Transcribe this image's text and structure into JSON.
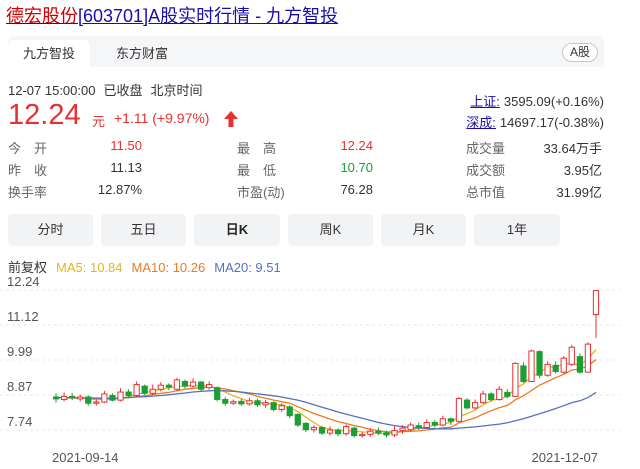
{
  "page": {
    "title_red": "德宏股份",
    "title_rest": "[603701]A股实时行情 - 九方智投"
  },
  "source_tabs": [
    {
      "label": "九方智投",
      "active": true
    },
    {
      "label": "东方财富",
      "active": false
    }
  ],
  "market_badge": "A股",
  "status": {
    "time": "12-07 15:00:00",
    "state": "已收盘",
    "zone": "北京时间"
  },
  "quote": {
    "price": "12.24",
    "unit": "元",
    "change": "+1.11 (+9.97%)",
    "direction": "up",
    "up_color": "#e93030",
    "down_color": "#1a9e36"
  },
  "indices": [
    {
      "label": "上证:",
      "value": "3595.09(+0.16%)"
    },
    {
      "label": "深成:",
      "value": "14697.17(-0.38%)"
    }
  ],
  "stats": [
    [
      {
        "label": "今　开",
        "value": "11.50",
        "color": "red"
      },
      {
        "label": "最　高",
        "value": "12.24",
        "color": "red"
      },
      {
        "label": "成交量",
        "value": "33.64万手",
        "color": ""
      }
    ],
    [
      {
        "label": "昨　收",
        "value": "11.13",
        "color": ""
      },
      {
        "label": "最　低",
        "value": "10.70",
        "color": "green"
      },
      {
        "label": "成交额",
        "value": "3.95亿",
        "color": ""
      }
    ],
    [
      {
        "label": "换手率",
        "value": "12.87%",
        "color": ""
      },
      {
        "label": "市盈(动)",
        "value": "76.28",
        "color": ""
      },
      {
        "label": "总市值",
        "value": "31.99亿",
        "color": ""
      }
    ]
  ],
  "period_tabs": [
    {
      "label": "分时",
      "active": false
    },
    {
      "label": "五日",
      "active": false
    },
    {
      "label": "日K",
      "active": true
    },
    {
      "label": "周K",
      "active": false
    },
    {
      "label": "月K",
      "active": false
    },
    {
      "label": "1年",
      "active": false
    }
  ],
  "ma_legend": {
    "adjust": "前复权",
    "items": [
      {
        "label": "MA5: 10.84",
        "color": "#e6b422"
      },
      {
        "label": "MA10: 10.26",
        "color": "#f07a1a"
      },
      {
        "label": "MA20: 9.51",
        "color": "#5470c6"
      }
    ]
  },
  "chart_data": {
    "type": "candlestick",
    "y_ticks": [
      "12.24",
      "11.12",
      "9.99",
      "8.87",
      "7.74"
    ],
    "y_range": [
      7.74,
      12.24
    ],
    "x_labels": [
      "2021-09-14",
      "2021-12-07"
    ],
    "up_color": "#e93030",
    "down_color": "#1a9e36",
    "candles": [
      {
        "o": 8.8,
        "c": 8.74,
        "h": 8.92,
        "l": 8.62
      },
      {
        "o": 8.72,
        "c": 8.82,
        "h": 8.95,
        "l": 8.66
      },
      {
        "o": 8.82,
        "c": 8.78,
        "h": 8.93,
        "l": 8.7
      },
      {
        "o": 8.74,
        "c": 8.8,
        "h": 8.88,
        "l": 8.66
      },
      {
        "o": 8.8,
        "c": 8.6,
        "h": 8.86,
        "l": 8.52
      },
      {
        "o": 8.6,
        "c": 8.64,
        "h": 8.72,
        "l": 8.52
      },
      {
        "o": 8.64,
        "c": 8.9,
        "h": 9.0,
        "l": 8.6
      },
      {
        "o": 8.85,
        "c": 8.7,
        "h": 8.92,
        "l": 8.66
      },
      {
        "o": 8.7,
        "c": 8.96,
        "h": 9.08,
        "l": 8.66
      },
      {
        "o": 8.96,
        "c": 8.85,
        "h": 9.05,
        "l": 8.76
      },
      {
        "o": 8.85,
        "c": 9.2,
        "h": 9.3,
        "l": 8.78
      },
      {
        "o": 9.15,
        "c": 8.92,
        "h": 9.2,
        "l": 8.86
      },
      {
        "o": 8.92,
        "c": 9.05,
        "h": 9.2,
        "l": 8.86
      },
      {
        "o": 9.05,
        "c": 9.18,
        "h": 9.28,
        "l": 8.98
      },
      {
        "o": 9.18,
        "c": 9.12,
        "h": 9.24,
        "l": 9.02
      },
      {
        "o": 9.05,
        "c": 9.35,
        "h": 9.42,
        "l": 9.0
      },
      {
        "o": 9.3,
        "c": 9.15,
        "h": 9.36,
        "l": 9.08
      },
      {
        "o": 9.15,
        "c": 9.28,
        "h": 9.4,
        "l": 9.1
      },
      {
        "o": 9.28,
        "c": 9.05,
        "h": 9.32,
        "l": 8.98
      },
      {
        "o": 9.1,
        "c": 9.2,
        "h": 9.3,
        "l": 9.04
      },
      {
        "o": 9.1,
        "c": 8.72,
        "h": 9.14,
        "l": 8.66
      },
      {
        "o": 8.72,
        "c": 8.6,
        "h": 8.8,
        "l": 8.52
      },
      {
        "o": 8.6,
        "c": 8.65,
        "h": 8.72,
        "l": 8.55
      },
      {
        "o": 8.66,
        "c": 8.58,
        "h": 8.74,
        "l": 8.52
      },
      {
        "o": 8.58,
        "c": 8.68,
        "h": 8.78,
        "l": 8.52
      },
      {
        "o": 8.68,
        "c": 8.55,
        "h": 8.74,
        "l": 8.48
      },
      {
        "o": 8.55,
        "c": 8.62,
        "h": 8.7,
        "l": 8.46
      },
      {
        "o": 8.62,
        "c": 8.4,
        "h": 8.66,
        "l": 8.34
      },
      {
        "o": 8.4,
        "c": 8.52,
        "h": 8.6,
        "l": 8.32
      },
      {
        "o": 8.48,
        "c": 8.2,
        "h": 8.54,
        "l": 8.12
      },
      {
        "o": 8.24,
        "c": 7.9,
        "h": 8.28,
        "l": 7.84
      },
      {
        "o": 7.95,
        "c": 7.75,
        "h": 8.0,
        "l": 7.68
      },
      {
        "o": 7.75,
        "c": 7.82,
        "h": 7.9,
        "l": 7.66
      },
      {
        "o": 7.82,
        "c": 7.64,
        "h": 7.88,
        "l": 7.58
      },
      {
        "o": 7.64,
        "c": 7.74,
        "h": 7.86,
        "l": 7.56
      },
      {
        "o": 7.74,
        "c": 7.62,
        "h": 7.8,
        "l": 7.54
      },
      {
        "o": 7.62,
        "c": 7.85,
        "h": 7.92,
        "l": 7.56
      },
      {
        "o": 7.8,
        "c": 7.56,
        "h": 7.84,
        "l": 7.5
      },
      {
        "o": 7.56,
        "c": 7.6,
        "h": 7.68,
        "l": 7.5
      },
      {
        "o": 7.6,
        "c": 7.7,
        "h": 7.8,
        "l": 7.52
      },
      {
        "o": 7.7,
        "c": 7.65,
        "h": 7.82,
        "l": 7.58
      },
      {
        "o": 7.65,
        "c": 7.58,
        "h": 7.72,
        "l": 7.5
      },
      {
        "o": 7.58,
        "c": 7.72,
        "h": 7.86,
        "l": 7.52
      },
      {
        "o": 7.72,
        "c": 7.8,
        "h": 7.9,
        "l": 7.62
      },
      {
        "o": 7.75,
        "c": 7.9,
        "h": 7.98,
        "l": 7.68
      },
      {
        "o": 7.88,
        "c": 7.82,
        "h": 7.98,
        "l": 7.74
      },
      {
        "o": 7.82,
        "c": 7.98,
        "h": 8.08,
        "l": 7.78
      },
      {
        "o": 7.98,
        "c": 7.9,
        "h": 8.06,
        "l": 7.82
      },
      {
        "o": 7.9,
        "c": 8.1,
        "h": 8.2,
        "l": 7.86
      },
      {
        "o": 8.1,
        "c": 8.02,
        "h": 8.14,
        "l": 7.9
      },
      {
        "o": 8.02,
        "c": 8.75,
        "h": 8.8,
        "l": 7.98
      },
      {
        "o": 8.7,
        "c": 8.45,
        "h": 8.76,
        "l": 8.4
      },
      {
        "o": 8.45,
        "c": 8.62,
        "h": 8.72,
        "l": 8.4
      },
      {
        "o": 8.62,
        "c": 8.9,
        "h": 9.0,
        "l": 8.58
      },
      {
        "o": 8.9,
        "c": 8.72,
        "h": 8.95,
        "l": 8.65
      },
      {
        "o": 8.72,
        "c": 9.05,
        "h": 9.15,
        "l": 8.68
      },
      {
        "o": 8.95,
        "c": 8.82,
        "h": 9.05,
        "l": 8.76
      },
      {
        "o": 8.82,
        "c": 9.88,
        "h": 9.92,
        "l": 8.8
      },
      {
        "o": 9.8,
        "c": 9.3,
        "h": 9.92,
        "l": 9.25
      },
      {
        "o": 9.3,
        "c": 10.28,
        "h": 10.32,
        "l": 9.28
      },
      {
        "o": 10.26,
        "c": 9.5,
        "h": 10.3,
        "l": 9.4
      },
      {
        "o": 9.5,
        "c": 9.85,
        "h": 9.95,
        "l": 9.45
      },
      {
        "o": 9.82,
        "c": 9.62,
        "h": 9.95,
        "l": 9.55
      },
      {
        "o": 9.6,
        "c": 10.05,
        "h": 10.12,
        "l": 9.55
      },
      {
        "o": 9.85,
        "c": 10.4,
        "h": 10.48,
        "l": 9.8
      },
      {
        "o": 10.1,
        "c": 9.6,
        "h": 10.2,
        "l": 9.55
      },
      {
        "o": 9.6,
        "c": 10.5,
        "h": 10.56,
        "l": 9.58
      },
      {
        "o": 11.45,
        "c": 12.22,
        "h": 12.24,
        "l": 10.7
      }
    ],
    "ma5": [
      8.78,
      8.77,
      8.77,
      8.76,
      8.75,
      8.71,
      8.74,
      8.73,
      8.76,
      8.81,
      8.9,
      8.93,
      9.0,
      9.04,
      9.1,
      9.12,
      9.17,
      9.16,
      9.17,
      9.16,
      9.06,
      8.96,
      8.84,
      8.75,
      8.65,
      8.6,
      8.6,
      8.57,
      8.55,
      8.46,
      8.33,
      8.15,
      7.98,
      7.82,
      7.77,
      7.71,
      7.73,
      7.7,
      7.68,
      7.67,
      7.62,
      7.63,
      7.65,
      7.69,
      7.75,
      7.8,
      7.85,
      7.89,
      7.94,
      7.98,
      8.17,
      8.26,
      8.38,
      8.55,
      8.69,
      8.74,
      8.81,
      9.08,
      9.22,
      9.46,
      9.58,
      9.77,
      9.76,
      9.86,
      9.89,
      9.82,
      10.03,
      10.32
    ],
    "ma10": [
      8.78,
      8.78,
      8.77,
      8.77,
      8.76,
      8.75,
      8.75,
      8.75,
      8.76,
      8.78,
      8.81,
      8.84,
      8.88,
      8.92,
      8.95,
      9.0,
      9.05,
      9.08,
      9.1,
      9.12,
      9.09,
      9.06,
      9.0,
      8.95,
      8.9,
      8.82,
      8.76,
      8.7,
      8.65,
      8.6,
      8.49,
      8.38,
      8.27,
      8.18,
      8.09,
      8.01,
      7.95,
      7.88,
      7.83,
      7.76,
      7.72,
      7.68,
      7.68,
      7.69,
      7.7,
      7.71,
      7.74,
      7.77,
      7.81,
      7.83,
      7.97,
      8.05,
      8.13,
      8.25,
      8.36,
      8.46,
      8.53,
      8.71,
      8.84,
      9.01,
      9.18,
      9.3,
      9.42,
      9.53,
      9.67,
      9.7,
      9.8,
      10.0
    ],
    "ma20": [
      8.78,
      8.78,
      8.78,
      8.77,
      8.77,
      8.77,
      8.76,
      8.76,
      8.77,
      8.78,
      8.8,
      8.81,
      8.83,
      8.85,
      8.87,
      8.9,
      8.93,
      8.96,
      8.98,
      9.0,
      9.01,
      9.0,
      8.98,
      8.96,
      8.93,
      8.9,
      8.87,
      8.84,
      8.8,
      8.75,
      8.7,
      8.63,
      8.55,
      8.47,
      8.4,
      8.32,
      8.25,
      8.18,
      8.12,
      8.05,
      7.98,
      7.93,
      7.88,
      7.85,
      7.82,
      7.8,
      7.79,
      7.78,
      7.78,
      7.78,
      7.8,
      7.82,
      7.84,
      7.87,
      7.9,
      7.93,
      7.97,
      8.04,
      8.1,
      8.18,
      8.26,
      8.34,
      8.43,
      8.52,
      8.62,
      8.68,
      8.78,
      8.95
    ]
  }
}
